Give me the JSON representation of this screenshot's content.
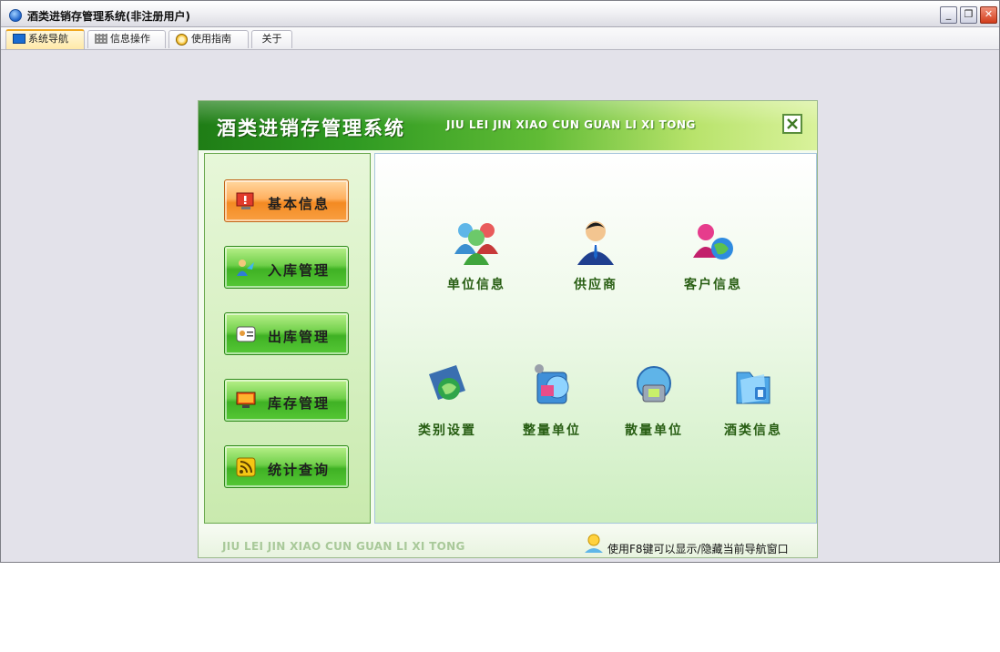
{
  "window": {
    "title": "酒类进销存管理系统(非注册用户)",
    "controls": {
      "minimize": "_",
      "maximize": "❐",
      "close": "✕"
    }
  },
  "tabs": [
    {
      "label": "系统导航",
      "icon": "monitor-icon",
      "active": true
    },
    {
      "label": "信息操作",
      "icon": "grid-icon",
      "active": false
    },
    {
      "label": "使用指南",
      "icon": "help-icon",
      "active": false
    },
    {
      "label": "关于",
      "icon": "",
      "active": false
    }
  ],
  "nav": {
    "title": "酒类进销存管理系统",
    "subtitle": "JIU LEI JIN XIAO CUN GUAN LI XI TONG",
    "menu": [
      {
        "label": "基本信息",
        "icon": "alert-monitor-icon",
        "active": true
      },
      {
        "label": "入库管理",
        "icon": "stock-in-icon",
        "active": false
      },
      {
        "label": "出库管理",
        "icon": "stock-out-icon",
        "active": false
      },
      {
        "label": "库存管理",
        "icon": "inventory-monitor-icon",
        "active": false
      },
      {
        "label": "统计查询",
        "icon": "rss-icon",
        "active": false
      }
    ],
    "features": [
      {
        "label": "单位信息",
        "icon": "users-group-icon"
      },
      {
        "label": "供应商",
        "icon": "supplier-person-icon"
      },
      {
        "label": "客户信息",
        "icon": "customers-globe-icon"
      },
      {
        "label": "类别设置",
        "icon": "category-globe-icon"
      },
      {
        "label": "整量单位",
        "icon": "whole-unit-icon"
      },
      {
        "label": "散量单位",
        "icon": "bulk-unit-icon"
      },
      {
        "label": "酒类信息",
        "icon": "wine-folder-icon"
      }
    ],
    "footer_left": "JIU LEI JIN XIAO CUN GUAN LI XI TONG",
    "footer_hint": "使用F8键可以显示/隐藏当前导航窗口"
  },
  "colors": {
    "accent_green": "#3fb124",
    "active_orange": "#f38a22",
    "label_green": "#275d12"
  }
}
